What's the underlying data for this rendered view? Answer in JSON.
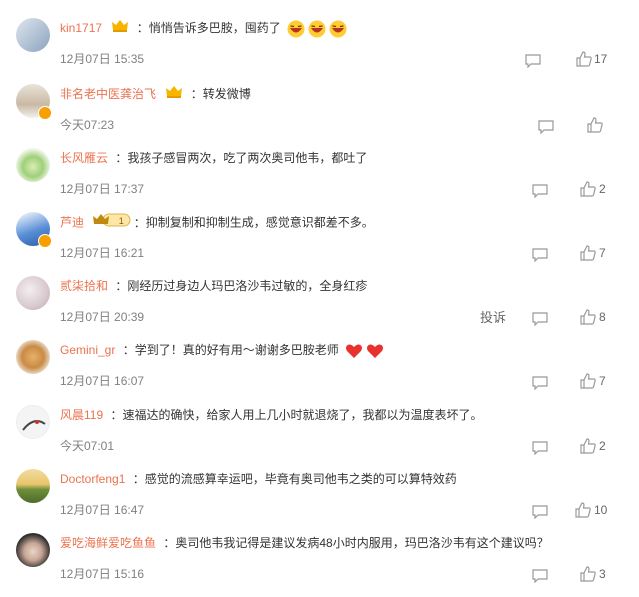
{
  "comments": [
    {
      "name": "kin1717",
      "crown": true,
      "vip_label": "",
      "text": "悄悄告诉多巴胺，囤药了",
      "emojis": 3,
      "time": "12月07日 15:35",
      "likes": "17",
      "report": ""
    },
    {
      "name": "非名老中医龚治飞",
      "crown": true,
      "vip_label": "",
      "text": "转发微博",
      "emojis": 0,
      "time": "今天07:23",
      "likes": "",
      "report": ""
    },
    {
      "name": "长风雁云",
      "crown": false,
      "vip_label": "",
      "text": "我孩子感冒两次，吃了两次奥司他韦，都吐了",
      "emojis": 0,
      "time": "12月07日 17:37",
      "likes": "2",
      "report": ""
    },
    {
      "name": "芦迪",
      "crown": false,
      "vip_label": "1",
      "text": "抑制复制和抑制生成，感觉意识都差不多。",
      "emojis": 0,
      "time": "12月07日 16:21",
      "likes": "7",
      "report": ""
    },
    {
      "name": "贰柒拾和",
      "crown": false,
      "vip_label": "",
      "text": "刚经历过身边人玛巴洛沙韦过敏的，全身红疹",
      "emojis": 0,
      "time": "12月07日 20:39",
      "likes": "8",
      "report": "投诉"
    },
    {
      "name": "Gemini_gr",
      "crown": false,
      "vip_label": "",
      "text": "学到了！真的好有用～谢谢多巴胺老师",
      "emojis": 0,
      "hearts": 2,
      "time": "12月07日 16:07",
      "likes": "7",
      "report": ""
    },
    {
      "name": "风晨119",
      "crown": false,
      "vip_label": "",
      "text": "速福达的确快，给家人用上几小时就退烧了，我都以为温度表坏了。",
      "emojis": 0,
      "time": "今天07:01",
      "likes": "2",
      "report": ""
    },
    {
      "name": "Doctorfeng1",
      "crown": false,
      "vip_label": "",
      "text": "感觉的流感算幸运吧，毕竟有奥司他韦之类的可以算特效药",
      "emojis": 0,
      "time": "12月07日 16:47",
      "likes": "10",
      "report": ""
    },
    {
      "name": "爱吃海鲜爱吃鱼鱼",
      "crown": false,
      "vip_label": "",
      "text": "奥司他韦我记得是建议发病48小时内服用，玛巴洛沙韦有这个建议吗？",
      "emojis": 0,
      "time": "12月07日 15:16",
      "likes": "3",
      "report": ""
    }
  ],
  "colors": {
    "name": "#eb7350",
    "text": "#333333",
    "time": "#808080",
    "icon": "#999999",
    "heart": "#e8322e",
    "vip": "#f7a000"
  },
  "icons": {
    "comment": "comment-icon",
    "like": "thumbs-up-icon",
    "crown": "crown-icon",
    "vip": "verified-badge-icon",
    "emoji": "laughing-emoji-icon",
    "heart": "heart-icon"
  }
}
